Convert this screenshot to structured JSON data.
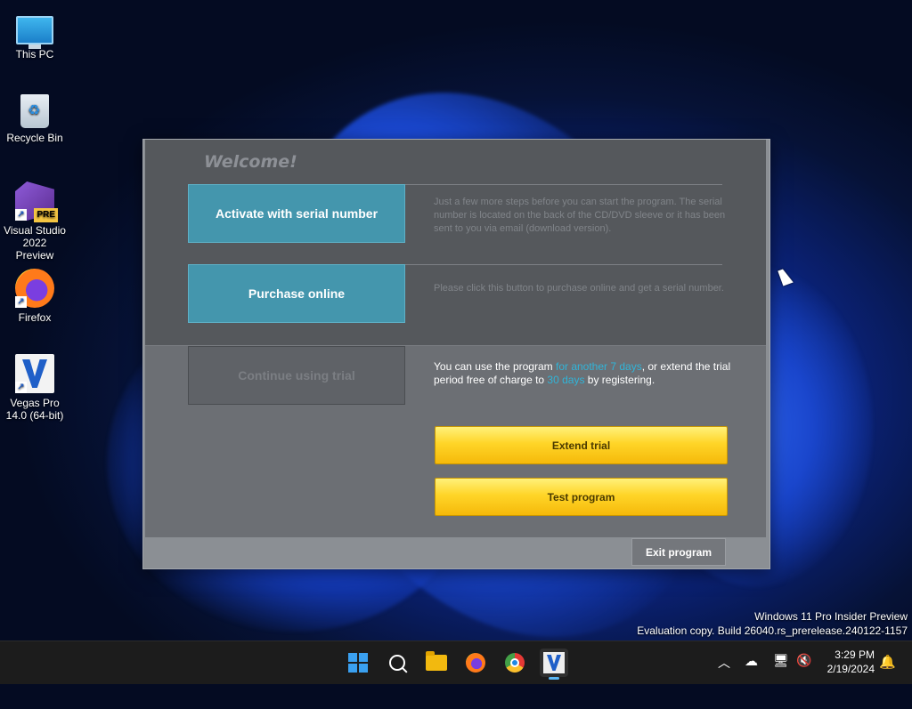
{
  "desktop": {
    "icons": [
      {
        "label": "This PC"
      },
      {
        "label": "Recycle Bin"
      },
      {
        "label": "Visual Studio 2022 Preview",
        "badge": "PRE"
      },
      {
        "label": "Firefox"
      },
      {
        "label": "Vegas Pro 14.0 (64-bit)"
      }
    ]
  },
  "dialog": {
    "title": "Welcome!",
    "activate": {
      "label": "Activate with serial number",
      "description": "Just a few more steps before you can start the program. The serial number is located on the back of the CD/DVD sleeve or it has been sent to you via email (download version)."
    },
    "purchase": {
      "label": "Purchase online",
      "description": "Please click this button to purchase online and get a serial number."
    },
    "trial": {
      "label": "Continue using trial",
      "text_1": "You can use the program ",
      "highlight_1": "for another 7 days",
      "text_2": ", or extend the trial period free of charge to ",
      "highlight_2": "30 days",
      "text_3": " by registering."
    },
    "extend_trial_label": "Extend trial",
    "test_program_label": "Test program",
    "exit_label": "Exit program",
    "colors": {
      "accent_blue": "#4496ad",
      "highlight": "#31b4d8",
      "yellow": "#ffd528"
    }
  },
  "watermark": {
    "line1": "Windows 11 Pro Insider Preview",
    "line2": "Evaluation copy. Build 26040.rs_prerelease.240122-1157"
  },
  "taskbar": {
    "apps": [
      "start-icon",
      "search-icon",
      "file-explorer-icon",
      "firefox-icon",
      "chrome-icon",
      "vegas-pro-icon"
    ],
    "active_app": "vegas-pro-icon",
    "time": "3:29 PM",
    "date": "2/19/2024"
  }
}
